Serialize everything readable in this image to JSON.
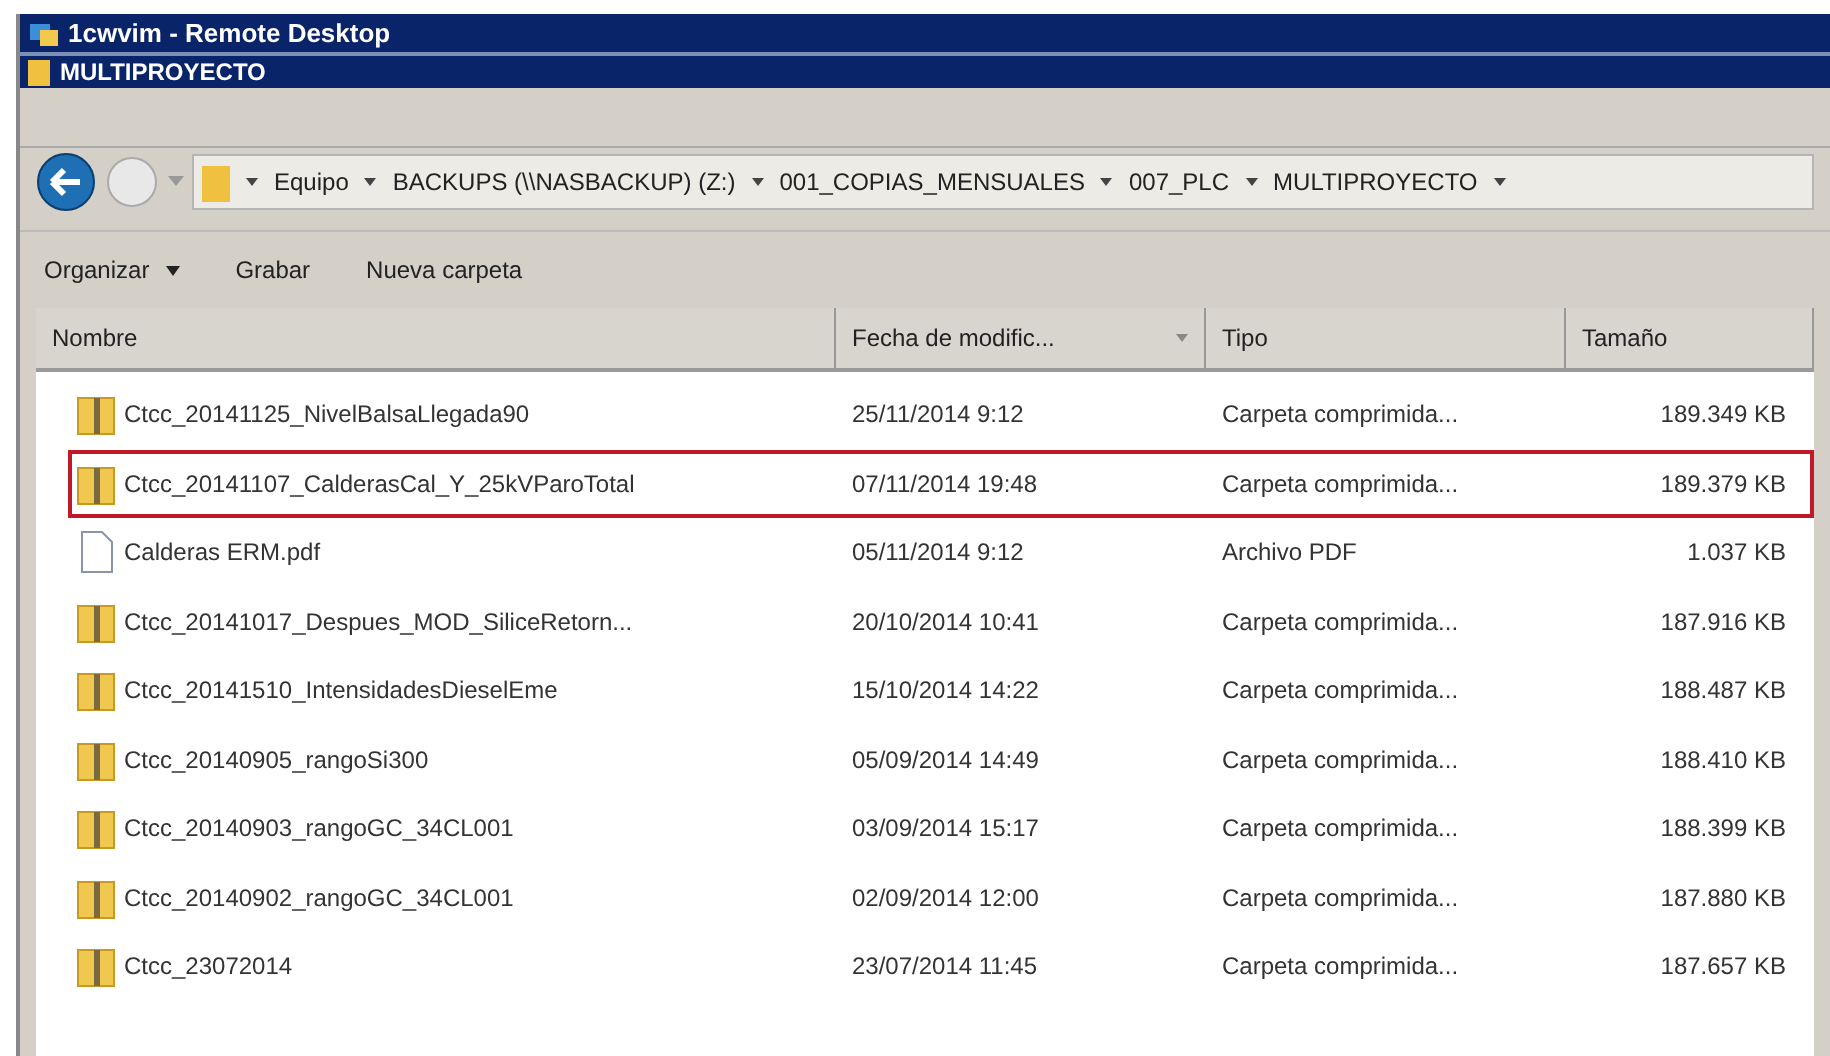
{
  "remote_window": {
    "title": "1cwvim - Remote Desktop"
  },
  "window": {
    "title": "MULTIPROYECTO"
  },
  "address_bar": {
    "breadcrumbs": [
      "Equipo",
      "BACKUPS (\\\\NASBACKUP) (Z:)",
      "001_COPIAS_MENSUALES",
      "007_PLC",
      "MULTIPROYECTO"
    ]
  },
  "toolbar": {
    "buttons": [
      {
        "label": "Organizar",
        "dropdown": true
      },
      {
        "label": "Grabar",
        "dropdown": false
      },
      {
        "label": "Nueva carpeta",
        "dropdown": false
      }
    ]
  },
  "table": {
    "columns": [
      {
        "label": "Nombre",
        "sorted": false
      },
      {
        "label": "Fecha de modific...",
        "sorted": true
      },
      {
        "label": "Tipo",
        "sorted": false
      },
      {
        "label": "Tamaño",
        "sorted": false
      }
    ],
    "rows": [
      {
        "kind": "folder",
        "name": "Ctcc_20141125_NivelBalsaLlegada90",
        "date": "25/11/2014 9:12",
        "type": "Carpeta comprimida...",
        "size": "189.349 KB",
        "highlighted": false
      },
      {
        "kind": "folder",
        "name": "Ctcc_20141107_CalderasCal_Y_25kVParoTotal",
        "date": "07/11/2014 19:48",
        "type": "Carpeta comprimida...",
        "size": "189.379 KB",
        "highlighted": true
      },
      {
        "kind": "file",
        "name": "Calderas ERM.pdf",
        "date": "05/11/2014 9:12",
        "type": "Archivo PDF",
        "size": "1.037 KB",
        "highlighted": false
      },
      {
        "kind": "folder",
        "name": "Ctcc_20141017_Despues_MOD_SiliceRetorn...",
        "date": "20/10/2014 10:41",
        "type": "Carpeta comprimida...",
        "size": "187.916 KB",
        "highlighted": false
      },
      {
        "kind": "folder",
        "name": "Ctcc_20141510_IntensidadesDieselEme",
        "date": "15/10/2014 14:22",
        "type": "Carpeta comprimida...",
        "size": "188.487 KB",
        "highlighted": false
      },
      {
        "kind": "folder",
        "name": "Ctcc_20140905_rangoSi300",
        "date": "05/09/2014 14:49",
        "type": "Carpeta comprimida...",
        "size": "188.410 KB",
        "highlighted": false
      },
      {
        "kind": "folder",
        "name": "Ctcc_20140903_rangoGC_34CL001",
        "date": "03/09/2014 15:17",
        "type": "Carpeta comprimida...",
        "size": "188.399 KB",
        "highlighted": false
      },
      {
        "kind": "folder",
        "name": "Ctcc_20140902_rangoGC_34CL001",
        "date": "02/09/2014 12:00",
        "type": "Carpeta comprimida...",
        "size": "187.880 KB",
        "highlighted": false
      },
      {
        "kind": "folder",
        "name": "Ctcc_23072014",
        "date": "23/07/2014 11:45",
        "type": "Carpeta comprimida...",
        "size": "187.657 KB",
        "highlighted": false
      }
    ]
  }
}
